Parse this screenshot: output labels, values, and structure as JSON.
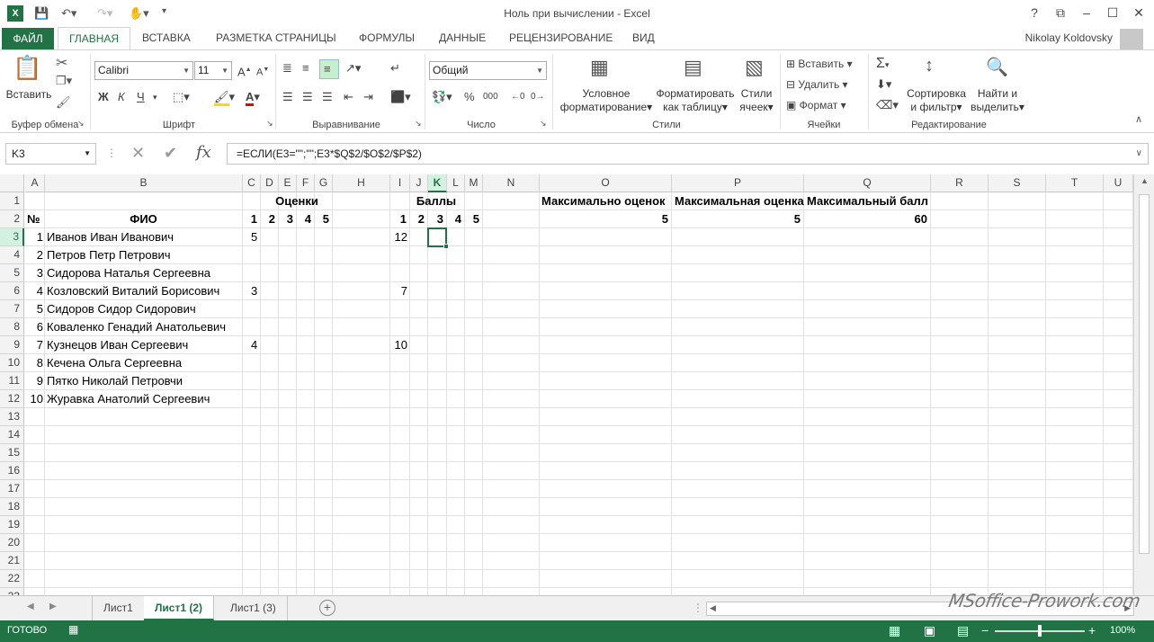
{
  "window": {
    "title": "Ноль при вычислении - Excel",
    "app_icon": "X",
    "user": "Nikolay Koldovsky",
    "controls": [
      "?",
      "⧉",
      "–",
      "☐",
      "✕"
    ]
  },
  "tabs": {
    "file": "ФАЙЛ",
    "items": [
      "ГЛАВНАЯ",
      "ВСТАВКА",
      "РАЗМЕТКА СТРАНИЦЫ",
      "ФОРМУЛЫ",
      "ДАННЫЕ",
      "РЕЦЕНЗИРОВАНИЕ",
      "ВИД"
    ],
    "active": "ГЛАВНАЯ"
  },
  "ribbon": {
    "clipboard": {
      "paste": "Вставить",
      "label": "Буфер обмена"
    },
    "font": {
      "name": "Calibri",
      "size": "11",
      "bold": "Ж",
      "italic": "К",
      "underline": "Ч",
      "label": "Шрифт"
    },
    "alignment": {
      "label": "Выравнивание"
    },
    "number": {
      "format": "Общий",
      "percent": "%",
      "thousands": "000",
      "label": "Число"
    },
    "styles": {
      "conditional_1": "Условное",
      "conditional_2": "форматирование",
      "as_table_1": "Форматировать",
      "as_table_2": "как таблицу",
      "cell_styles_1": "Стили",
      "cell_styles_2": "ячеек",
      "label": "Стили"
    },
    "cells": {
      "insert": "Вставить",
      "delete": "Удалить",
      "format": "Формат",
      "label": "Ячейки"
    },
    "editing": {
      "sort_1": "Сортировка",
      "sort_2": "и фильтр",
      "find_1": "Найти и",
      "find_2": "выделить",
      "label": "Редактирование"
    }
  },
  "formula_bar": {
    "name_box": "K3",
    "formula": "=ЕСЛИ(E3=\"\";\"\";E3*$Q$2/$O$2/$P$2)"
  },
  "grid": {
    "columns": [
      "A",
      "B",
      "C",
      "D",
      "E",
      "F",
      "G",
      "H",
      "I",
      "J",
      "K",
      "L",
      "M",
      "N",
      "O",
      "P",
      "Q",
      "R",
      "S",
      "T",
      "U"
    ],
    "active_column": "K",
    "rows": [
      "1",
      "2",
      "3",
      "4",
      "5",
      "6",
      "7",
      "8",
      "9",
      "10",
      "11",
      "12",
      "13",
      "14",
      "15",
      "16",
      "17",
      "18",
      "19",
      "20",
      "21",
      "22",
      "23"
    ],
    "active_row": "3",
    "header_row1": {
      "grades": "Оценки",
      "points": "Баллы",
      "max_grades": "Максимально оценок",
      "max_grade": "Максимальная оценка",
      "max_points": "Максимальный балл"
    },
    "header_row2": {
      "num": "№",
      "name": "ФИО",
      "grade_cols": [
        "1",
        "2",
        "3",
        "4",
        "5"
      ],
      "point_cols": [
        "1",
        "2",
        "3",
        "4",
        "5"
      ],
      "o2": "5",
      "p2": "5",
      "q2": "60"
    },
    "students": [
      {
        "n": "1",
        "name": "Иванов Иван Иванович",
        "c": "5",
        "i": "12"
      },
      {
        "n": "2",
        "name": "Петров Петр Петрович",
        "c": "",
        "i": ""
      },
      {
        "n": "3",
        "name": "Сидорова Наталья Сергеевна",
        "c": "",
        "i": ""
      },
      {
        "n": "4",
        "name": "Козловский Виталий Борисович",
        "c": "3",
        "i": "7"
      },
      {
        "n": "5",
        "name": "Сидоров Сидор Сидорович",
        "c": "",
        "i": ""
      },
      {
        "n": "6",
        "name": "Коваленко Генадий Анатольевич",
        "c": "",
        "i": ""
      },
      {
        "n": "7",
        "name": "Кузнецов Иван Сергеевич",
        "c": "4",
        "i": "10"
      },
      {
        "n": "8",
        "name": "Кечена Ольга Сергеевна",
        "c": "",
        "i": ""
      },
      {
        "n": "9",
        "name": "Пятко Николай Петровчи",
        "c": "",
        "i": ""
      },
      {
        "n": "10",
        "name": "Журавка Анатолий Сергеевич",
        "c": "",
        "i": ""
      }
    ]
  },
  "sheets": {
    "tabs": [
      "Лист1",
      "Лист1 (2)",
      "Лист1 (3)"
    ],
    "active": "Лист1 (2)"
  },
  "watermark": "MSoffice-Prowork.com",
  "status": {
    "text": "ГОТОВО",
    "zoom": "100%"
  },
  "colors": {
    "accent": "#217346",
    "active_header": "#d3f0e0"
  }
}
